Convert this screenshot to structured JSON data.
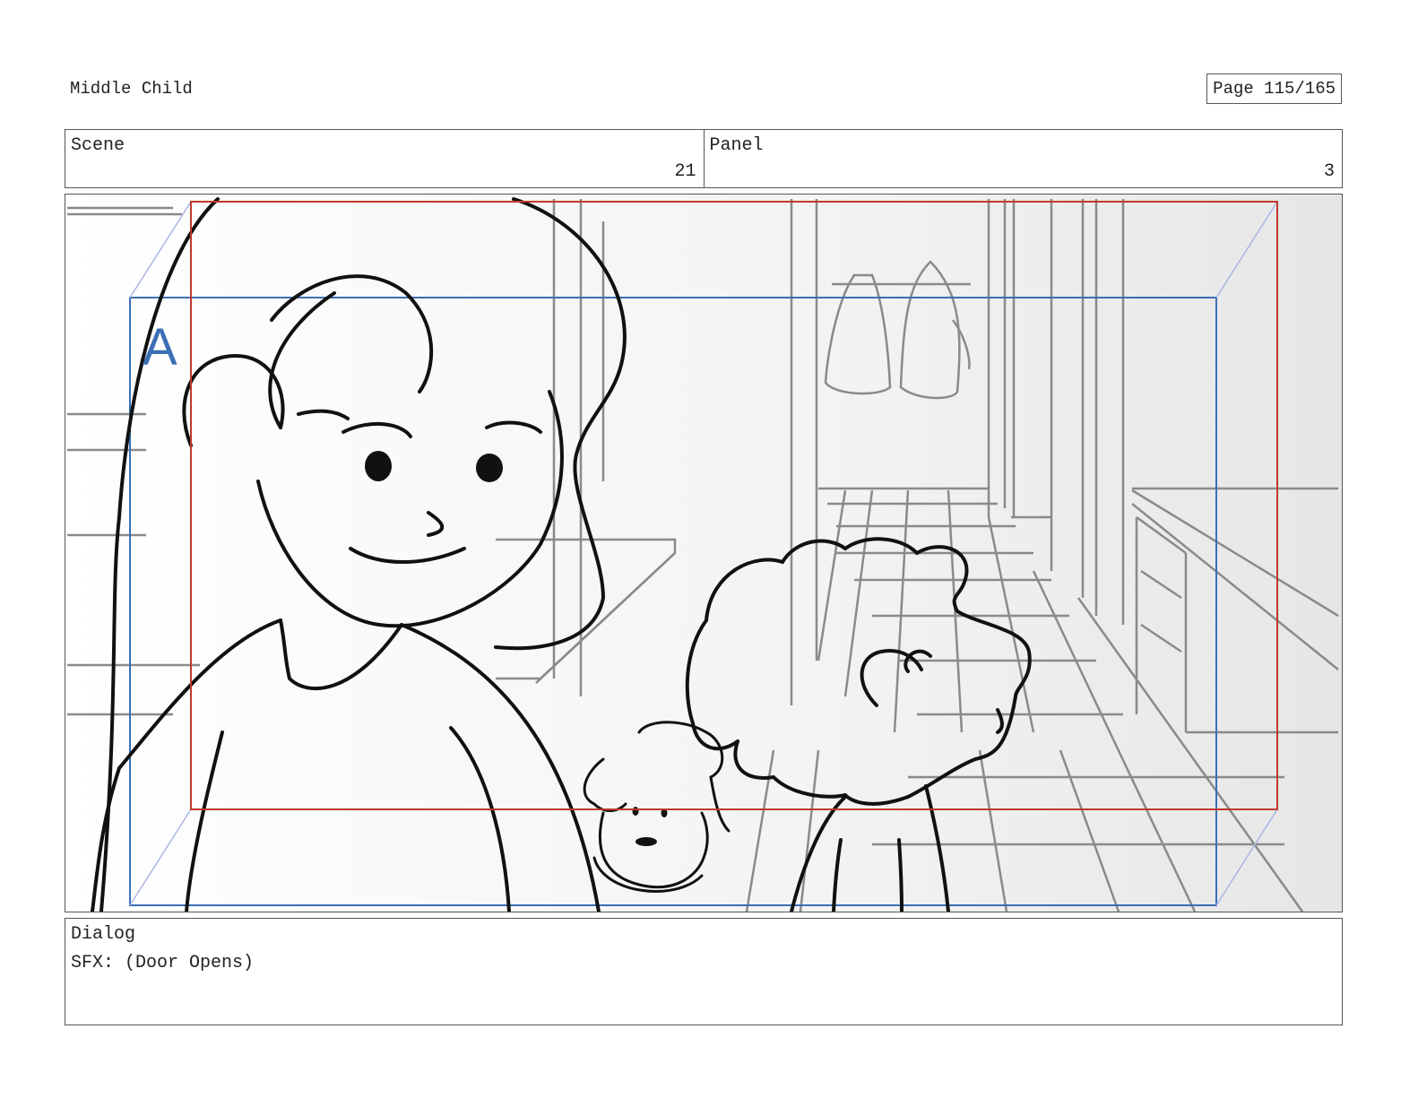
{
  "header": {
    "project_title": "Middle Child",
    "page_label": "Page 115/165"
  },
  "info": {
    "scene_label": "Scene",
    "scene_number": "21",
    "panel_label": "Panel",
    "panel_number": "3"
  },
  "panel": {
    "field_marker": "A",
    "camera_frame_color": "#c0392b",
    "field_guide_color": "#3a6fb5"
  },
  "dialog": {
    "label": "Dialog",
    "text": "SFX: (Door Opens)"
  }
}
